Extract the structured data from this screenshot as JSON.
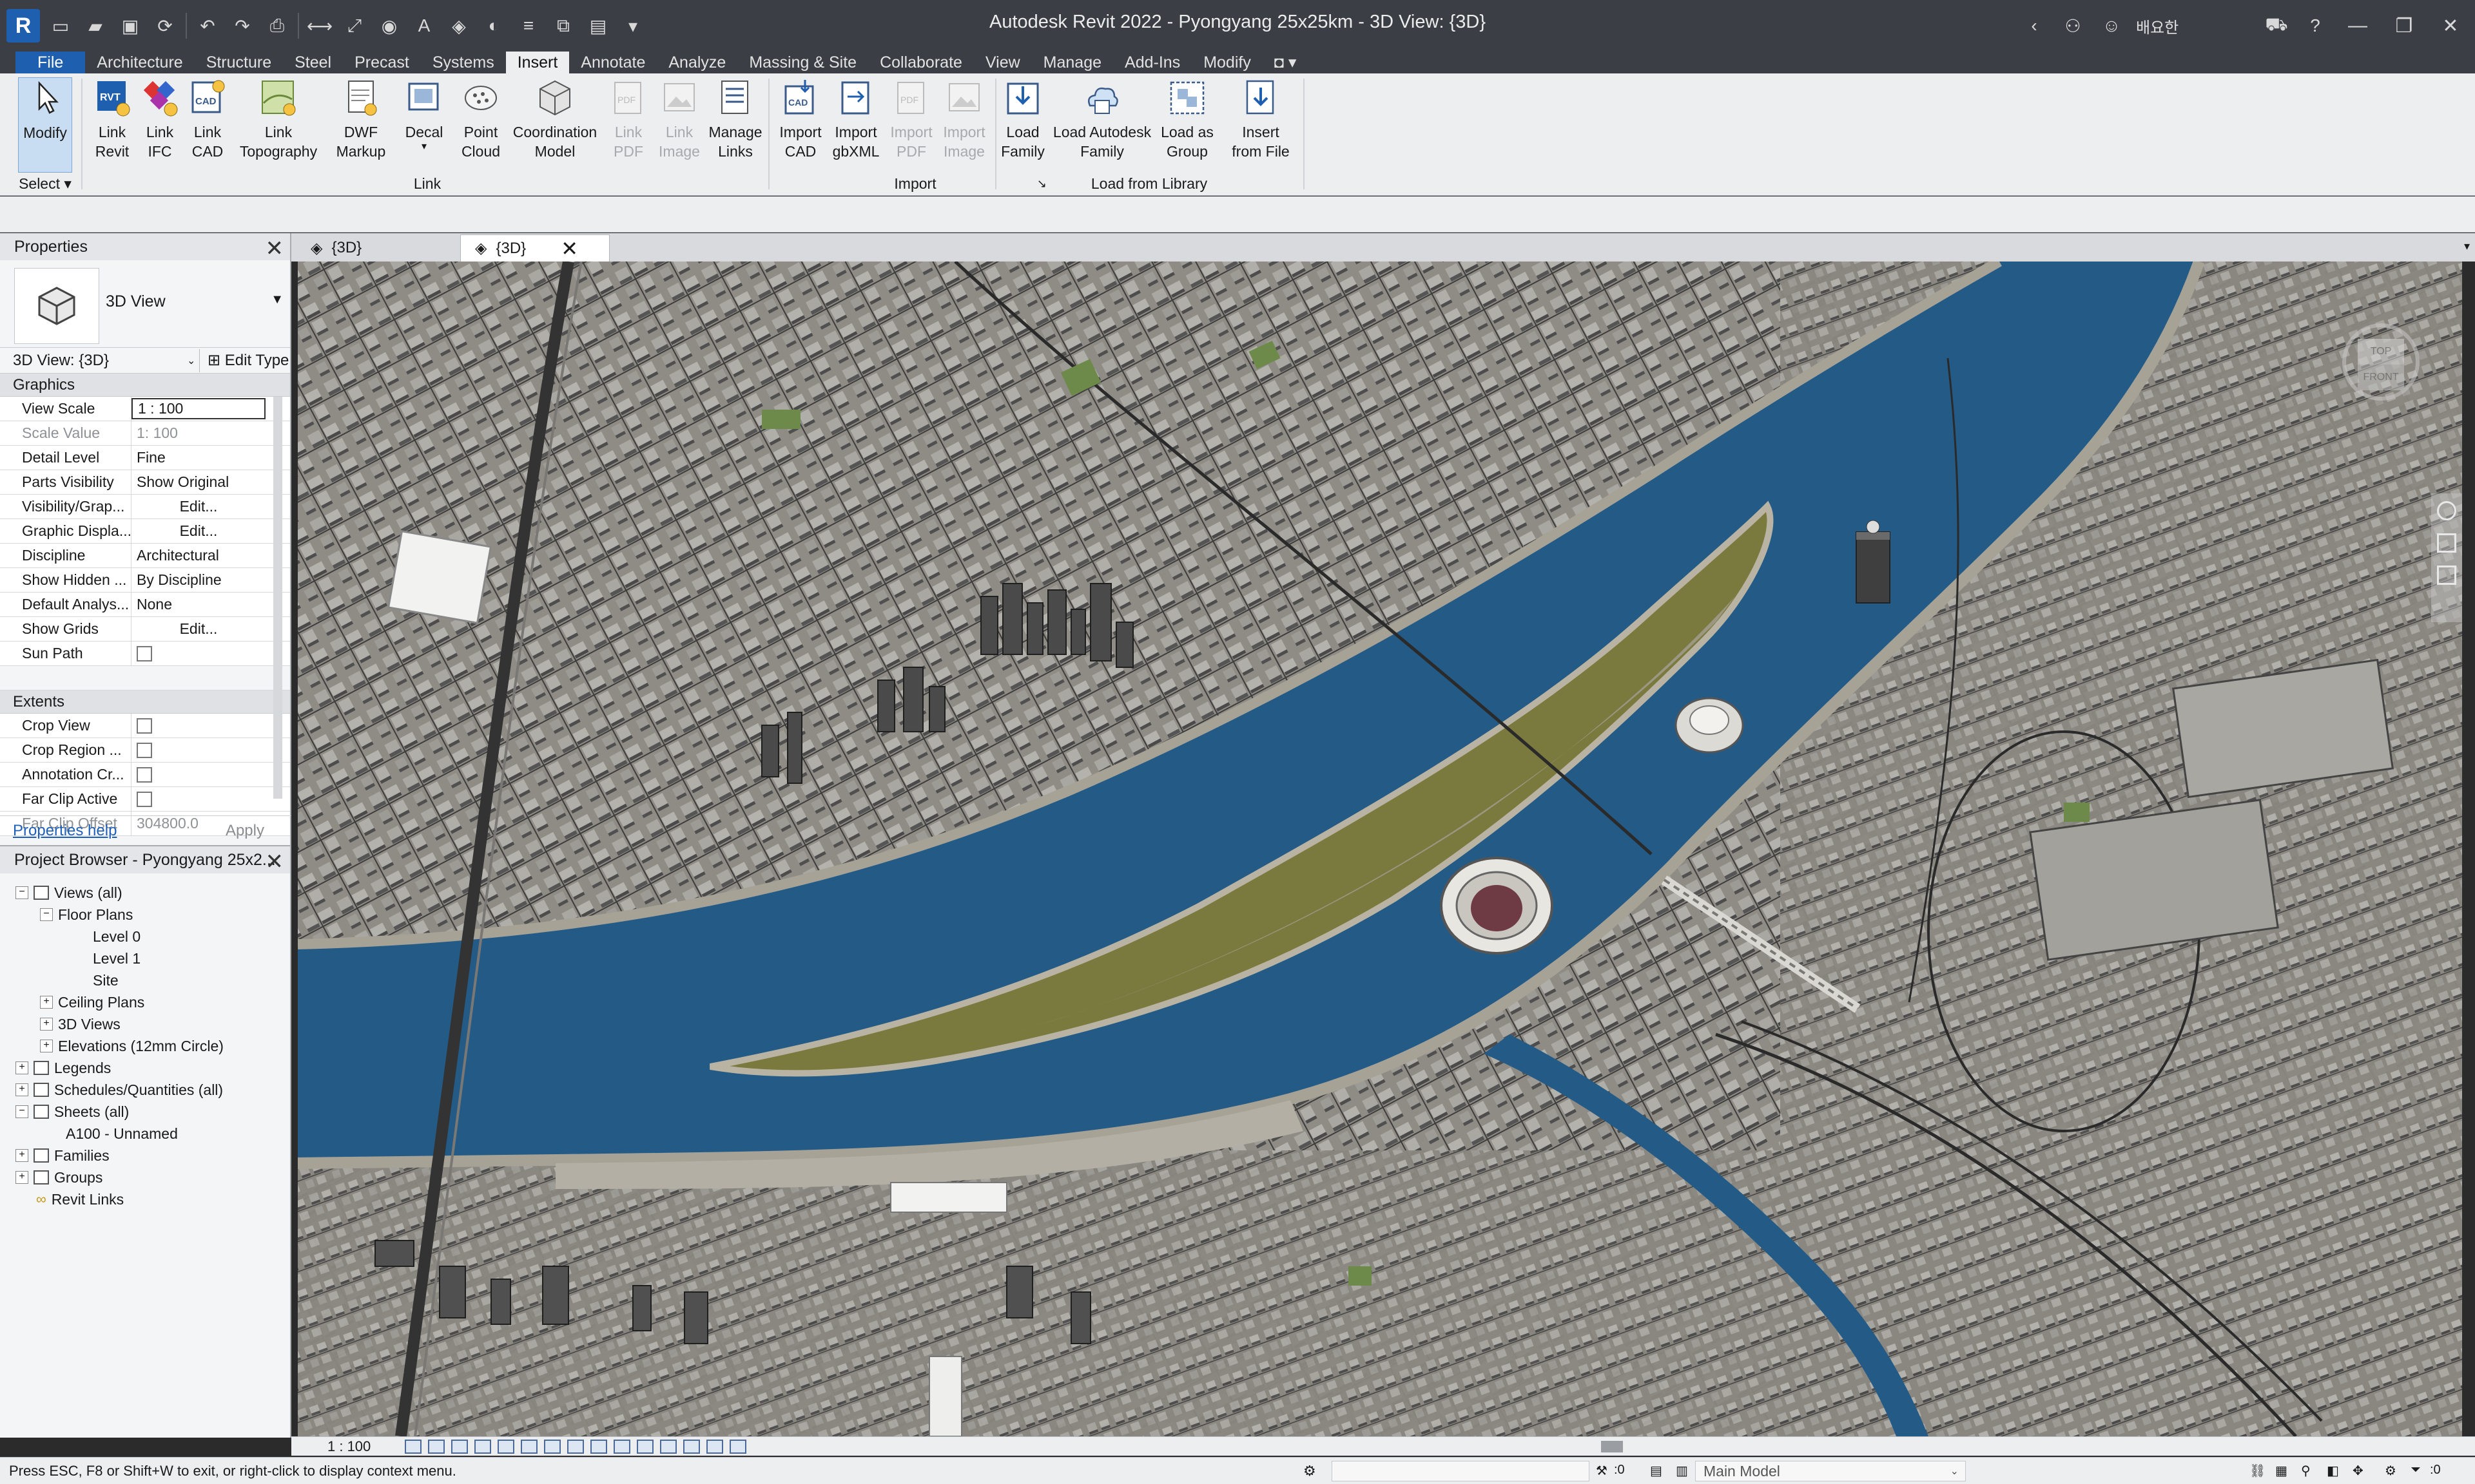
{
  "window": {
    "title": "Autodesk Revit 2022 - Pyongyang 25x25km - 3D View: {3D}",
    "user": "배요한"
  },
  "ribbon_tabs": [
    "File",
    "Architecture",
    "Structure",
    "Steel",
    "Precast",
    "Systems",
    "Insert",
    "Annotate",
    "Analyze",
    "Massing & Site",
    "Collaborate",
    "View",
    "Manage",
    "Add-Ins",
    "Modify"
  ],
  "active_tab": "Insert",
  "ribbon": {
    "modify": "Modify",
    "select_group": "Select",
    "link_revit": [
      "Link",
      "Revit"
    ],
    "link_ifc": [
      "Link",
      "IFC"
    ],
    "link_cad": [
      "Link",
      "CAD"
    ],
    "link_topography": [
      "Link",
      "Topography"
    ],
    "dwf_markup": [
      "DWF",
      "Markup"
    ],
    "decal": "Decal",
    "point_cloud": [
      "Point",
      "Cloud"
    ],
    "coordination_model": [
      "Coordination",
      "Model"
    ],
    "link_pdf": [
      "Link",
      "PDF"
    ],
    "link_image": [
      "Link",
      "Image"
    ],
    "manage_links": [
      "Manage",
      "Links"
    ],
    "link_group": "Link",
    "import_cad": [
      "Import",
      "CAD"
    ],
    "import_gbxml": [
      "Import",
      "gbXML"
    ],
    "import_pdf": [
      "Import",
      "PDF"
    ],
    "import_image": [
      "Import",
      "Image"
    ],
    "import_group": "Import",
    "load_family": [
      "Load",
      "Family"
    ],
    "load_autodesk_family": [
      "Load Autodesk",
      "Family"
    ],
    "load_as_group": [
      "Load as",
      "Group"
    ],
    "insert_from_file": [
      "Insert",
      "from File"
    ],
    "library_group": "Load from Library"
  },
  "properties": {
    "title": "Properties",
    "type_name": "3D View",
    "instance_selector": "3D View: {3D}",
    "edit_type": "Edit Type",
    "sections": {
      "graphics": "Graphics",
      "extents": "Extents"
    },
    "graphics_rows": [
      {
        "key": "View Scale",
        "value": "1 : 100"
      },
      {
        "key": "Scale Value",
        "value": "1: 100"
      },
      {
        "key": "Detail Level",
        "value": "Fine"
      },
      {
        "key": "Parts Visibility",
        "value": "Show Original"
      },
      {
        "key": "Visibility/Grap...",
        "value": "Edit..."
      },
      {
        "key": "Graphic Displa...",
        "value": "Edit..."
      },
      {
        "key": "Discipline",
        "value": "Architectural"
      },
      {
        "key": "Show Hidden ...",
        "value": "By Discipline"
      },
      {
        "key": "Default Analys...",
        "value": "None"
      },
      {
        "key": "Show Grids",
        "value": "Edit..."
      },
      {
        "key": "Sun Path",
        "value": ""
      }
    ],
    "extents_rows": [
      {
        "key": "Crop View",
        "value": ""
      },
      {
        "key": "Crop Region ...",
        "value": ""
      },
      {
        "key": "Annotation Cr...",
        "value": ""
      },
      {
        "key": "Far Clip Active",
        "value": ""
      },
      {
        "key": "Far Clip Offset",
        "value": "304800.0"
      }
    ],
    "help": "Properties help",
    "apply": "Apply"
  },
  "project_browser": {
    "title": "Project Browser - Pyongyang 25x2...",
    "nodes": [
      "Views (all)",
      "Floor Plans",
      "Level 0",
      "Level 1",
      "Site",
      "Ceiling Plans",
      "3D Views",
      "Elevations (12mm Circle)",
      "Legends",
      "Schedules/Quantities (all)",
      "Sheets (all)",
      "A100 - Unnamed",
      "Families",
      "Groups",
      "Revit Links"
    ]
  },
  "view_tabs": [
    "{3D}",
    "{3D}"
  ],
  "viewcube": {
    "top": "TOP",
    "front": "FRONT"
  },
  "view_control": {
    "scale": "1 : 100"
  },
  "status": {
    "message": "Press ESC, F8 or Shift+W to exit, or right-click to display context menu.",
    "model": "Main Model",
    "filter_count": ":0",
    "worksets_count": ":0"
  },
  "colors": {
    "accent": "#1f5fb0",
    "river": "#245a86",
    "ground": "#8d8a83",
    "island_grass": "#7b7a3e"
  }
}
